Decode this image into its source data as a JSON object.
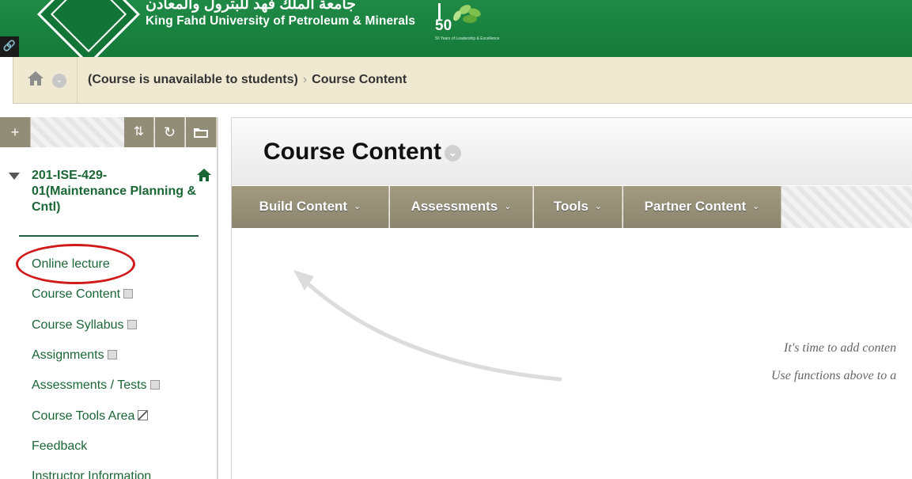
{
  "header": {
    "university_arabic": "جامعة الملك فهد للبترول والمعادن",
    "university_english": "King Fahd University of Petroleum & Minerals",
    "anniversary_number": "50",
    "anniversary_caption": "50 Years of Leadership & Excellence",
    "link_icon": "link-icon"
  },
  "breadcrumb": {
    "course": "(Course is unavailable to students)",
    "separator": "›",
    "current": "Course Content"
  },
  "left_nav": {
    "toolbar": {
      "add": "+",
      "sort": "⇅",
      "refresh": "↻",
      "folder": "folder-icon"
    },
    "course_title": "201-ISE-429-01(Maintenance Planning & Cntl)",
    "items": [
      {
        "label": "Online lecture",
        "hidden": false
      },
      {
        "label": "Course Content",
        "hidden": true
      },
      {
        "label": "Course Syllabus",
        "hidden": true
      },
      {
        "label": "Assignments",
        "hidden": true
      },
      {
        "label": "Assessments / Tests",
        "hidden": true
      },
      {
        "label": "Course Tools Area",
        "hidden": true
      },
      {
        "label": "Feedback",
        "hidden": false
      },
      {
        "label": "Instructor Information",
        "hidden": false
      }
    ]
  },
  "main": {
    "title": "Course Content",
    "actions": [
      {
        "label": "Build Content"
      },
      {
        "label": "Assessments"
      },
      {
        "label": "Tools"
      },
      {
        "label": "Partner Content"
      }
    ],
    "empty_line_1": "It's time to add conten",
    "empty_line_2": "Use functions above to a"
  },
  "colors": {
    "header_green": "#1a7f3f",
    "nav_text_green": "#1a6635",
    "breadcrumb_bg": "#efe9d2",
    "action_button": "#948e76",
    "annotation_red": "#d01a1a"
  }
}
